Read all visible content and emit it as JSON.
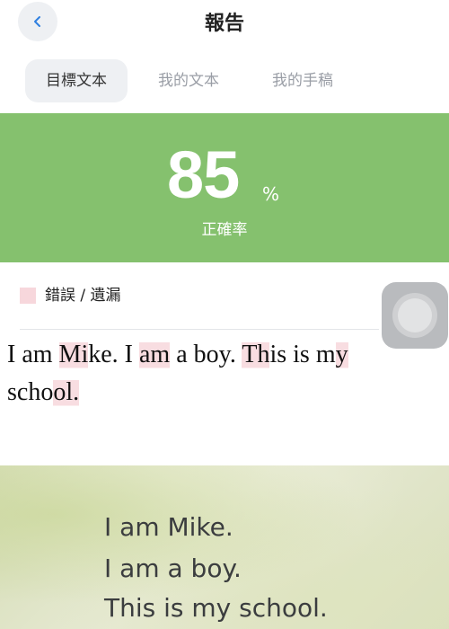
{
  "header": {
    "title": "報告",
    "back_icon": "chevron-left-icon"
  },
  "tabs": [
    {
      "label": "目標文本",
      "active": true
    },
    {
      "label": "我的文本",
      "active": false
    },
    {
      "label": "我的手稿",
      "active": false
    }
  ],
  "score": {
    "value": "85",
    "unit": "%",
    "label": "正確率",
    "panel_color": "#85c16e"
  },
  "legend": {
    "label": "錯誤 / 遺漏",
    "color": "#f7d7dc"
  },
  "reading": {
    "words": [
      {
        "text": "I",
        "error": false
      },
      {
        "text": "am",
        "error": false
      },
      {
        "text": "Mike.",
        "error": true,
        "error_chars": "Mi"
      },
      {
        "text": "I",
        "error": false
      },
      {
        "text": "am",
        "error": true
      },
      {
        "text": "a",
        "error": false
      },
      {
        "text": "boy.",
        "error": false
      },
      {
        "text": "This",
        "error": true,
        "error_chars": "Th"
      },
      {
        "text": "is",
        "error": false
      },
      {
        "text": "my",
        "error": true,
        "error_chars": "y"
      },
      {
        "text": "school.",
        "error": true,
        "error_chars": "ol."
      }
    ]
  },
  "photo": {
    "lines": [
      "I am Mike.",
      "I am a boy.",
      "This is my school."
    ]
  }
}
